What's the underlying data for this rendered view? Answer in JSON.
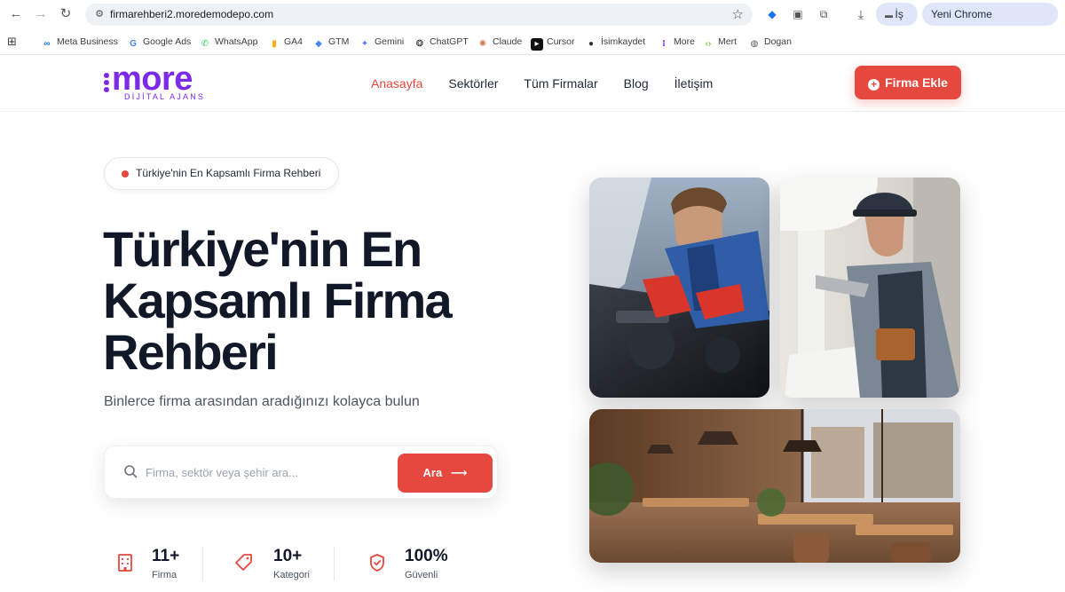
{
  "browser": {
    "url": "firmarehberi2.moredemodepo.com",
    "profile_label": "İş",
    "chrome_label": "Yeni Chrome kullanılabilir",
    "bookmarks": [
      {
        "label": "Meta Business",
        "icon": "meta-icon"
      },
      {
        "label": "Google Ads",
        "icon": "google-icon"
      },
      {
        "label": "WhatsApp",
        "icon": "whatsapp-icon"
      },
      {
        "label": "GA4",
        "icon": "analytics-icon"
      },
      {
        "label": "GTM",
        "icon": "gtm-icon"
      },
      {
        "label": "Gemini",
        "icon": "gemini-icon"
      },
      {
        "label": "ChatGPT",
        "icon": "chatgpt-icon"
      },
      {
        "label": "Claude",
        "icon": "claude-icon"
      },
      {
        "label": "Cursor",
        "icon": "cursor-icon"
      },
      {
        "label": "İsimkaydet",
        "icon": "isimkaydet-icon"
      },
      {
        "label": "More",
        "icon": "more-icon"
      },
      {
        "label": "Mert",
        "icon": "code-icon"
      },
      {
        "label": "Dogan",
        "icon": "globe-icon"
      }
    ]
  },
  "header": {
    "logo_word": "more",
    "logo_sub": "DİJİTAL AJANS",
    "nav": [
      {
        "label": "Anasayfa",
        "active": true
      },
      {
        "label": "Sektörler",
        "active": false
      },
      {
        "label": "Tüm Firmalar",
        "active": false
      },
      {
        "label": "Blog",
        "active": false
      },
      {
        "label": "İletişim",
        "active": false
      }
    ],
    "cta_label": "Firma Ekle"
  },
  "hero": {
    "badge": "Türkiye'nin En Kapsamlı Firma Rehberi",
    "title_lines": [
      "Türkiye'nin En",
      "Kapsamlı Firma",
      "Rehberi"
    ],
    "subtitle": "Binlerce firma arasından aradığınızı kolayca bulun",
    "search_placeholder": "Firma, sektör veya şehir ara...",
    "search_button": "Ara"
  },
  "stats": [
    {
      "value": "11+",
      "label": "Firma",
      "icon": "building-icon"
    },
    {
      "value": "10+",
      "label": "Kategori",
      "icon": "tag-icon"
    },
    {
      "value": "100%",
      "label": "Güvenli",
      "icon": "shield-check-icon"
    }
  ],
  "colors": {
    "accent": "#e5483e",
    "brand": "#7c2ae8",
    "text": "#111827"
  }
}
